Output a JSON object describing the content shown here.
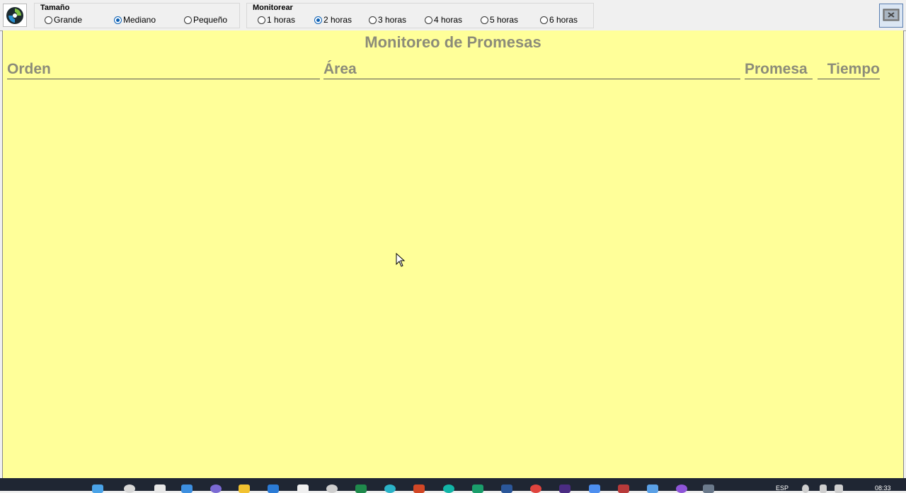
{
  "toolbar": {
    "size_group": {
      "title": "Tamaño",
      "options": [
        "Grande",
        "Mediano",
        "Pequeño"
      ],
      "selected": "Mediano"
    },
    "monitor_group": {
      "title": "Monitorear",
      "options": [
        "1 horas",
        "2 horas",
        "3 horas",
        "4 horas",
        "5 horas",
        "6 horas"
      ],
      "selected": "2 horas"
    }
  },
  "main": {
    "title": "Monitoreo de Promesas",
    "columns": {
      "orden": "Orden",
      "area": "Área",
      "promesa": "Promesa",
      "tiempo": "Tiempo"
    }
  },
  "taskbar": {
    "language": "ESP",
    "time": "08:33"
  },
  "colors": {
    "panel_background": "#ffff99",
    "header_text": "#8c8c79",
    "radio_selected": "#0a5fb4"
  }
}
